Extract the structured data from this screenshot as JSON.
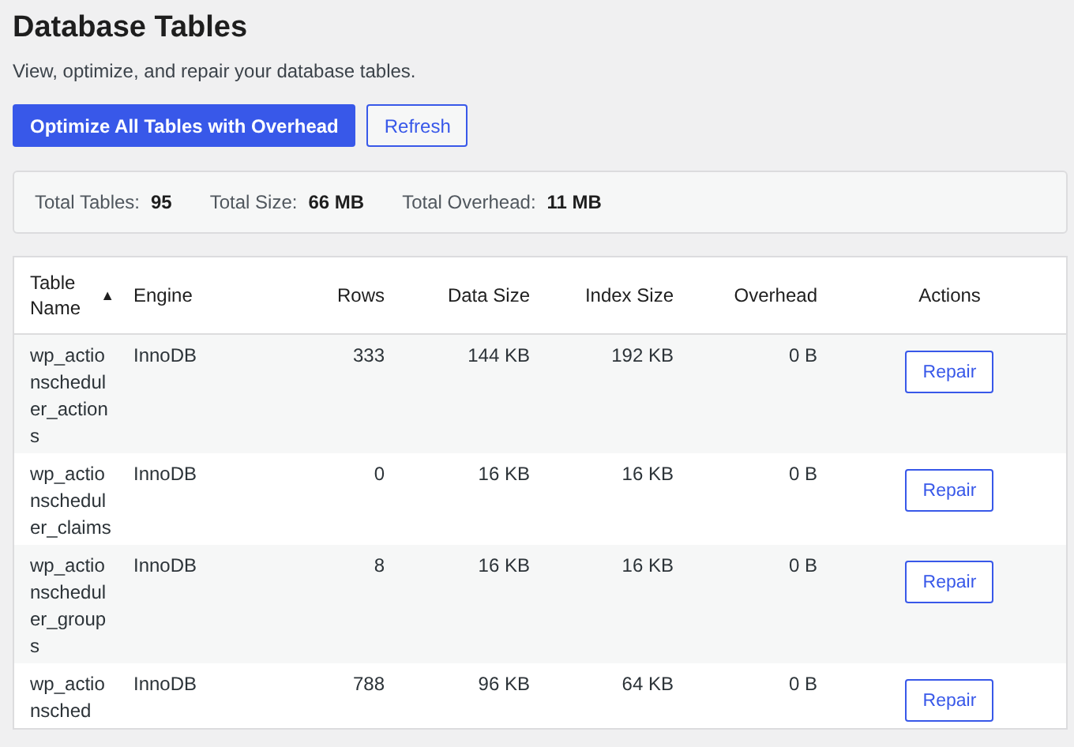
{
  "header": {
    "title": "Database Tables",
    "subtitle": "View, optimize, and repair your database tables."
  },
  "actions": [
    {
      "label": "Optimize All Tables with Overhead",
      "kind": "primary"
    },
    {
      "label": "Refresh",
      "kind": "secondary"
    }
  ],
  "summary": [
    {
      "label": "Total Tables:",
      "value": "95"
    },
    {
      "label": "Total Size:",
      "value": "66 MB"
    },
    {
      "label": "Total Overhead:",
      "value": "11 MB"
    }
  ],
  "table": {
    "columns": [
      {
        "label": "Table Name",
        "sort_mark": "▲"
      },
      {
        "label": "Engine"
      },
      {
        "label": "Rows"
      },
      {
        "label": "Data Size"
      },
      {
        "label": "Index Size"
      },
      {
        "label": "Overhead"
      },
      {
        "label": "Actions"
      }
    ],
    "rows": [
      {
        "cells": [
          "wp_actionscheduler_actions",
          "InnoDB",
          "333",
          "144 KB",
          "192 KB",
          "0 B"
        ],
        "action": "Repair"
      },
      {
        "cells": [
          "wp_actionscheduler_claims",
          "InnoDB",
          "0",
          "16 KB",
          "16 KB",
          "0 B"
        ],
        "action": "Repair"
      },
      {
        "cells": [
          "wp_actionscheduler_groups",
          "InnoDB",
          "8",
          "16 KB",
          "16 KB",
          "0 B"
        ],
        "action": "Repair"
      },
      {
        "cells": [
          "wp_actionsched",
          "InnoDB",
          "788",
          "96 KB",
          "64 KB",
          "0 B"
        ],
        "action": "Repair"
      }
    ]
  }
}
